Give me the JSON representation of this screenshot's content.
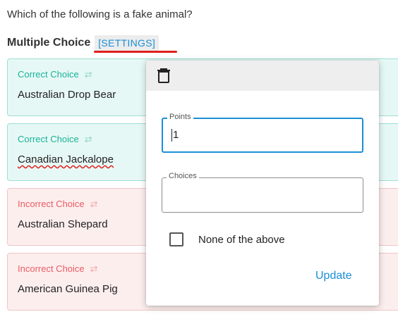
{
  "question": {
    "text": "Which of the following is a fake animal?"
  },
  "section": {
    "title": "Multiple Choice",
    "settings_label": "[SETTINGS]"
  },
  "choices": [
    {
      "status": "Correct Choice",
      "text": "Australian Drop Bear"
    },
    {
      "status": "Correct Choice",
      "text": "Canadian Jackalope"
    },
    {
      "status": "Incorrect Choice",
      "text": "Australian Shepard"
    },
    {
      "status": "Incorrect Choice",
      "text": "American Guinea Pig"
    }
  ],
  "popover": {
    "points_label": "Points",
    "points_value": "1",
    "choices_label": "Choices",
    "choices_value": "",
    "none_of_above_label": "None of the above",
    "none_of_above_checked": false,
    "update_label": "Update"
  },
  "icons": {
    "delete": "trash-icon",
    "swap": "swap-arrows-icon"
  },
  "colors": {
    "accent": "#1a8fd6",
    "correct": "#19b39a",
    "incorrect": "#ec5a61",
    "annotation": "#e0201b"
  }
}
